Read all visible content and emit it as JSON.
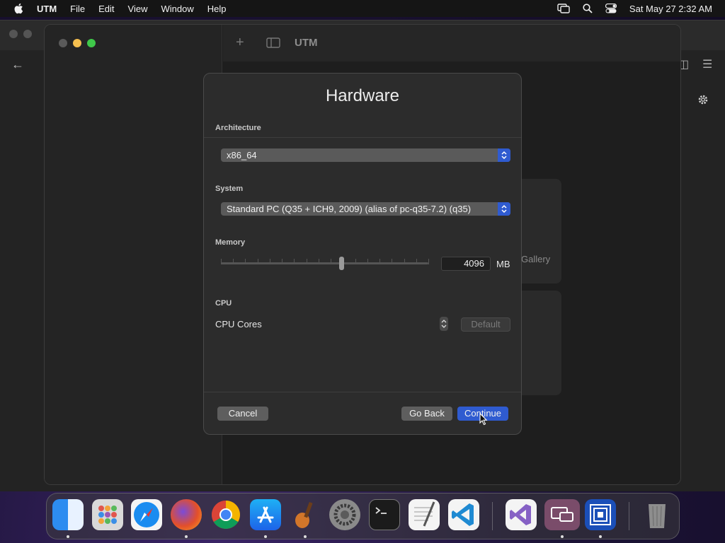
{
  "menubar": {
    "app_name": "UTM",
    "menus": [
      "File",
      "Edit",
      "View",
      "Window",
      "Help"
    ],
    "clock": "Sat May 27  2:32 AM",
    "icons": [
      "apple-icon",
      "screen-mirroring-icon",
      "spotlight-icon",
      "control-center-icon"
    ]
  },
  "utm_window": {
    "title": "UTM",
    "gallery_label": "Gallery"
  },
  "sheet": {
    "title": "Hardware",
    "architecture": {
      "label": "Architecture",
      "value": "x86_64"
    },
    "system": {
      "label": "System",
      "value": "Standard PC (Q35 + ICH9, 2009) (alias of pc-q35-7.2) (q35)"
    },
    "memory": {
      "label": "Memory",
      "value": "4096",
      "unit": "MB",
      "slider_fraction": 0.58
    },
    "cpu": {
      "label": "CPU",
      "cores_label": "CPU Cores",
      "default_label": "Default"
    },
    "buttons": {
      "cancel": "Cancel",
      "go_back": "Go Back",
      "continue": "Continue"
    }
  },
  "dock": {
    "apps": [
      "Finder",
      "Launchpad",
      "Safari",
      "Firefox",
      "Chrome",
      "App Store",
      "GarageBand",
      "System Settings",
      "Terminal",
      "TextEdit",
      "Visual Studio Code",
      "Visual Studio",
      "Screen Sharing",
      "UTM",
      "Trash"
    ]
  },
  "colors": {
    "accent": "#2f5bd0",
    "traffic_close": "#5a5a5a",
    "traffic_min": "#f5bf4f",
    "traffic_max": "#3fc84a"
  }
}
